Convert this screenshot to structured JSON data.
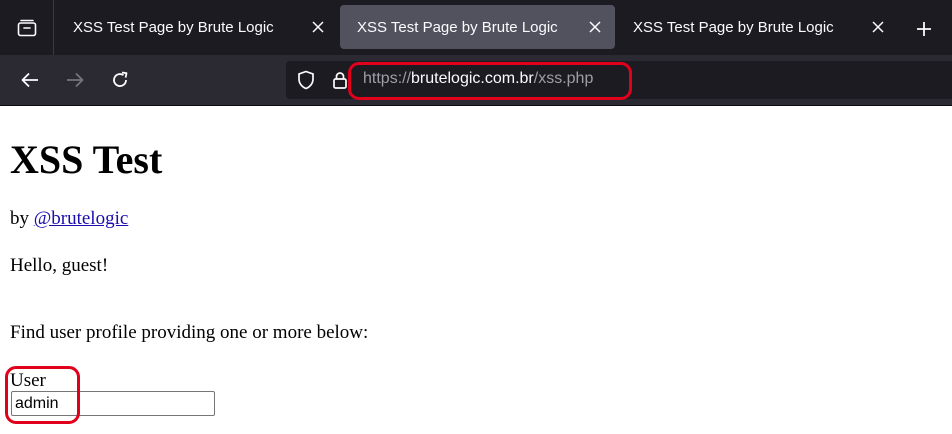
{
  "browser": {
    "tabs": [
      {
        "title": "XSS Test Page by Brute Logic",
        "active": false
      },
      {
        "title": "XSS Test Page by Brute Logic",
        "active": true
      },
      {
        "title": "XSS Test Page by Brute Logic",
        "active": false
      }
    ],
    "url": {
      "scheme": "https://",
      "domain": "brutelogic.com.br",
      "path": "/xss.php"
    },
    "colors": {
      "tabstrip_bg": "#1c1b22",
      "navbar_bg": "#2b2a33",
      "active_tab_bg": "#52525e",
      "highlight": "#e0001b"
    }
  },
  "page": {
    "title": "XSS Test",
    "byline_prefix": "by",
    "byline_link": "@brutelogic",
    "greeting": "Hello, guest!",
    "instruction": "Find user profile providing one or more below:",
    "user_label": "User",
    "user_value": "admin"
  }
}
